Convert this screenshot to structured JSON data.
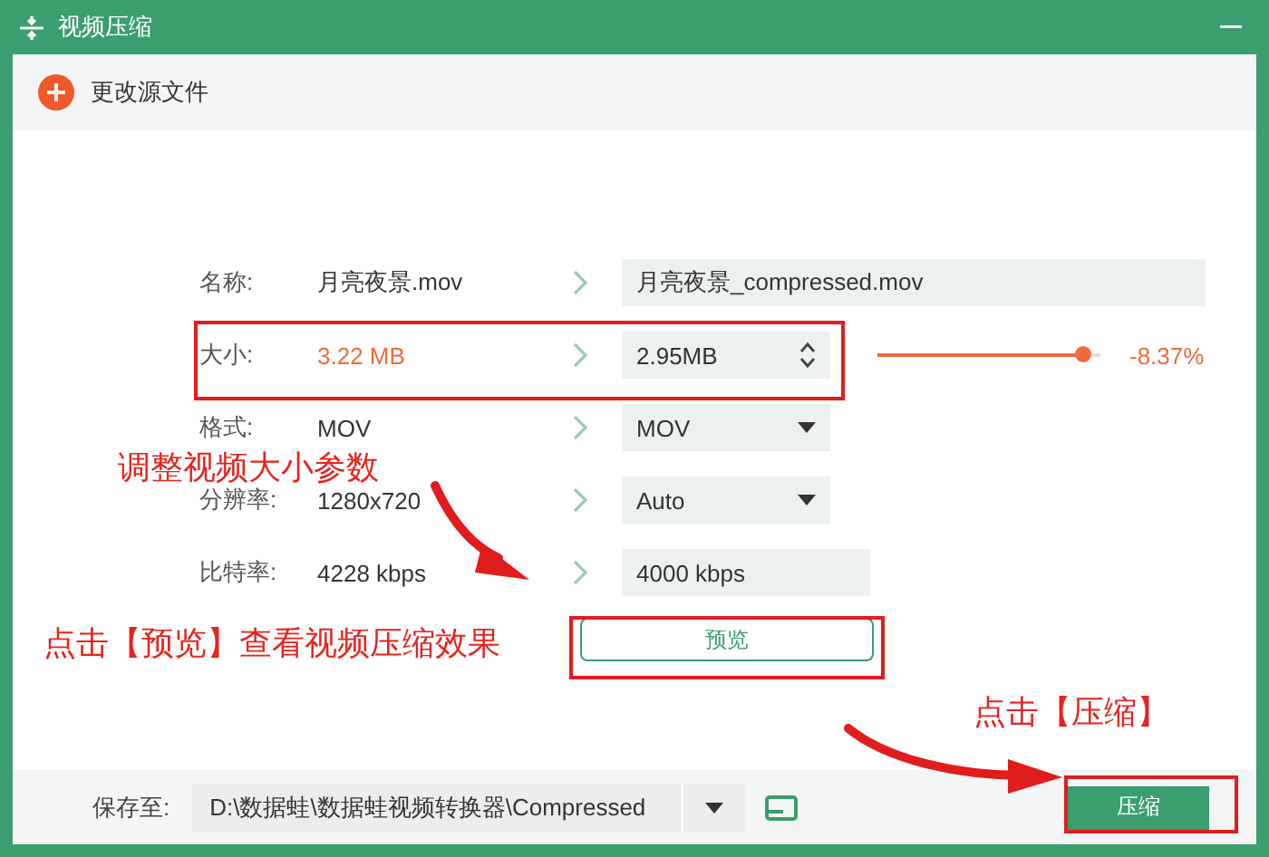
{
  "window": {
    "title": "视频压缩"
  },
  "toolbar": {
    "change_source": "更改源文件"
  },
  "rows": [
    {
      "kind": "text",
      "label": "名称:",
      "source": "月亮夜景.mov",
      "target": "月亮夜景_compressed.mov"
    },
    {
      "kind": "spinner",
      "label": "大小:",
      "source": "3.22 MB",
      "target": "2.95MB",
      "level": 0.92,
      "reading": "-8.37%"
    },
    {
      "kind": "dropdown",
      "label": "格式:",
      "source": "MOV",
      "target": "MOV"
    },
    {
      "kind": "dropdown",
      "label": "分辨率:",
      "source": "1280x720",
      "target": "Auto"
    },
    {
      "kind": "text",
      "label": "比特率:",
      "source": "4228 kbps",
      "target": "4000 kbps"
    }
  ],
  "preview_button": "预览",
  "save": {
    "label": "保存至:",
    "path": "D:\\数据蛙\\数据蛙视频转换器\\Compressed"
  },
  "compress_button": "压缩",
  "annotations": [
    {
      "kind": "size",
      "text": "调整视频大小参数"
    },
    {
      "kind": "preview",
      "text": "点击【预览】查看视频压缩效果"
    },
    {
      "kind": "compress",
      "text": "点击【压缩】"
    }
  ]
}
